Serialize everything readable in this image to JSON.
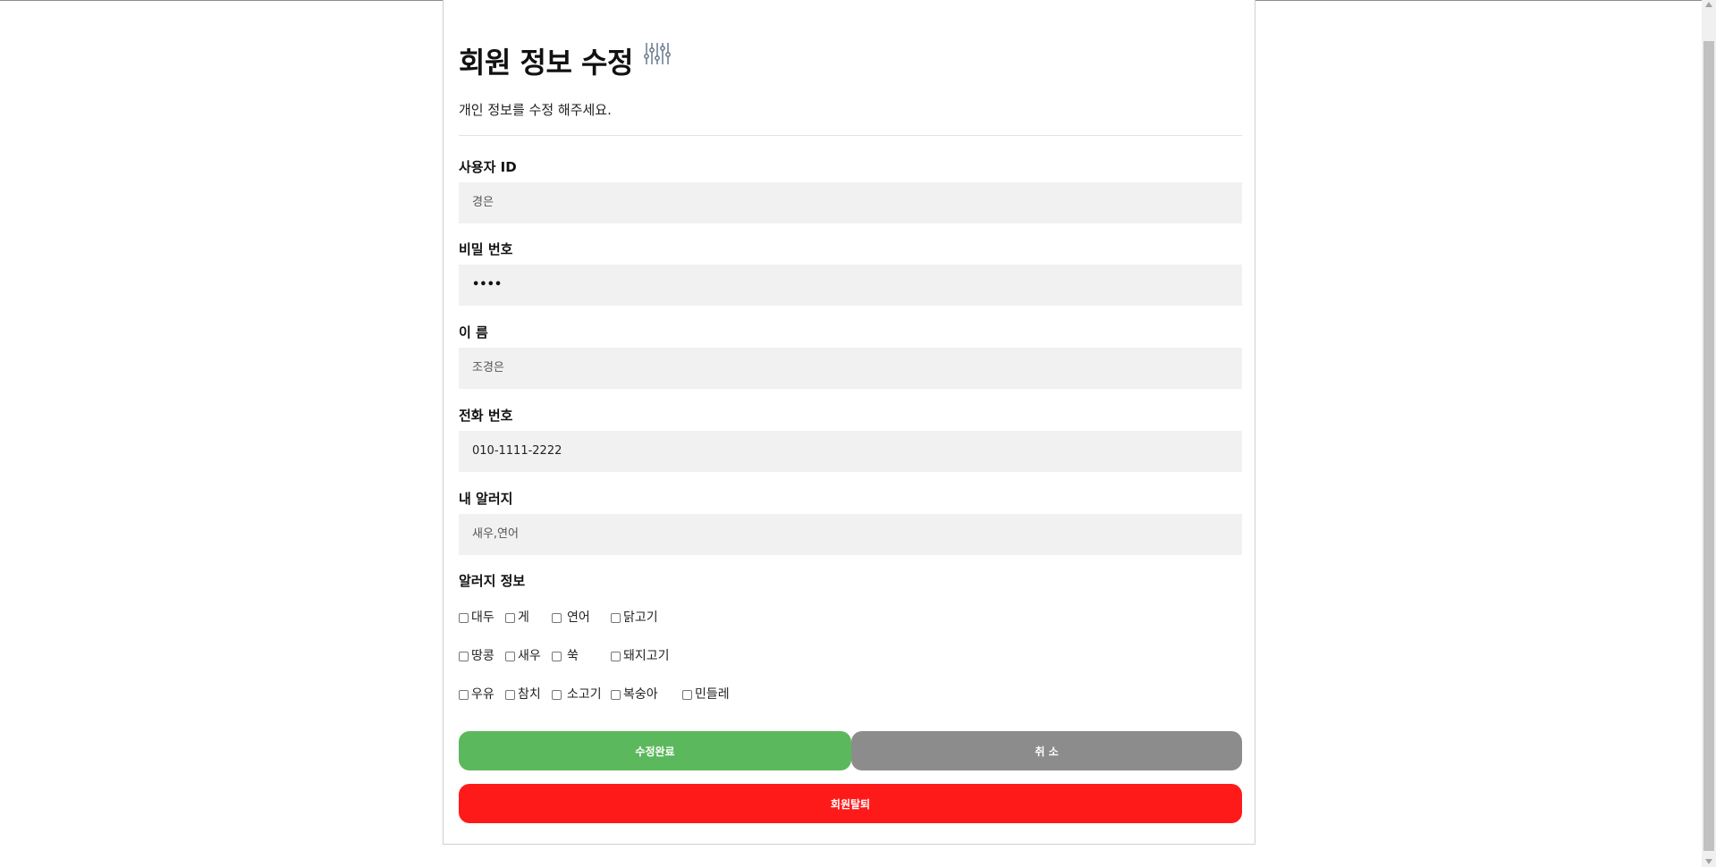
{
  "page": {
    "title": "회원 정보 수정",
    "title_icon": "sliders-icon",
    "subtitle": "개인 정보를 수정 해주세요."
  },
  "fields": {
    "user_id": {
      "label": "사용자 ID",
      "value": "경은"
    },
    "password": {
      "label": "비밀 번호",
      "value": "••••"
    },
    "name": {
      "label": "이 름",
      "value": "조경은"
    },
    "phone": {
      "label": "전화 번호",
      "value": "010-1111-2222"
    },
    "my_allergy": {
      "label": "내 알러지",
      "value": "새우,연어"
    }
  },
  "allergy_section": {
    "label": "알러지 정보",
    "options": [
      {
        "label": "대두",
        "checked": false
      },
      {
        "label": "게",
        "checked": false
      },
      {
        "label": "연어",
        "checked": false
      },
      {
        "label": "닭고기",
        "checked": false
      },
      {
        "label": "땅콩",
        "checked": false
      },
      {
        "label": "새우",
        "checked": false
      },
      {
        "label": "쑥",
        "checked": false
      },
      {
        "label": "돼지고기",
        "checked": false
      },
      {
        "label": "우유",
        "checked": false
      },
      {
        "label": "참치",
        "checked": false
      },
      {
        "label": "소고기",
        "checked": false
      },
      {
        "label": "복숭아",
        "checked": false
      },
      {
        "label": "민들레",
        "checked": false
      }
    ]
  },
  "buttons": {
    "save_label": "수정완료",
    "cancel_label": "취 소",
    "withdraw_label": "회원탈퇴"
  },
  "colors": {
    "save": "#5cb85c",
    "cancel": "#8c8c8c",
    "withdraw": "#ff1a1a",
    "input_bg": "#f1f1f1"
  }
}
